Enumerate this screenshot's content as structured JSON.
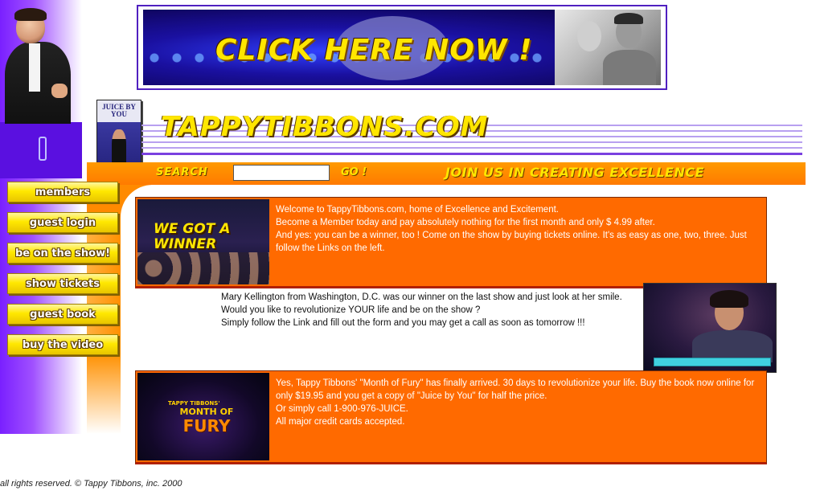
{
  "banner": {
    "text": "CLICK HERE NOW !"
  },
  "book": {
    "title": "JUICE BY YOU"
  },
  "site": {
    "title": "TAPPYTIBBONS.COM"
  },
  "search": {
    "label": "SEARCH",
    "value": "",
    "go_label": "GO !"
  },
  "slogan": "JOIN US IN CREATING EXCELLENCE",
  "nav": {
    "items": [
      {
        "label": "members"
      },
      {
        "label": "guest login"
      },
      {
        "label": "be on the show!"
      },
      {
        "label": "show tickets"
      },
      {
        "label": "guest book"
      },
      {
        "label": "buy the video"
      }
    ]
  },
  "box1": {
    "image_text": "WE GOT A WINNER",
    "lines": [
      "Welcome to TappyTibbons.com, home of Excellence and Excitement.",
      "Become a Member today and pay absolutely nothing for the first month and only $ 4.99 after.",
      "And yes: you can be a winner, too ! Come on the show by buying tickets online.  It's as easy as one, two, three. Just follow the Links on the left."
    ]
  },
  "middle": {
    "lines": [
      "Mary Kellington from Washington, D.C. was our winner on the last show and just look at her smile. Would you like to revolutionize YOUR life and be on the show ?",
      "Simply follow the Link and fill out the form and you may get a call as soon as tomorrow !!!"
    ]
  },
  "box3": {
    "image_sub": "TAPPY TIBBONS'",
    "image_title": "MONTH OF",
    "image_big": "FURY",
    "lines": [
      "Yes, Tappy Tibbons' \"Month of Fury\" has finally arrived. 30 days to revolutionize your life. Buy the book now online for only $19.95 and you get a copy of \"Juice by You\" for half the price.",
      "Or simply call 1-900-976-JUICE.",
      "All major credit cards accepted."
    ]
  },
  "footer": "all rights reserved. © Tappy Tibbons, inc. 2000",
  "colors": {
    "orange": "#ff6a00",
    "yellow": "#ffe600",
    "purple": "#7a20ff"
  }
}
